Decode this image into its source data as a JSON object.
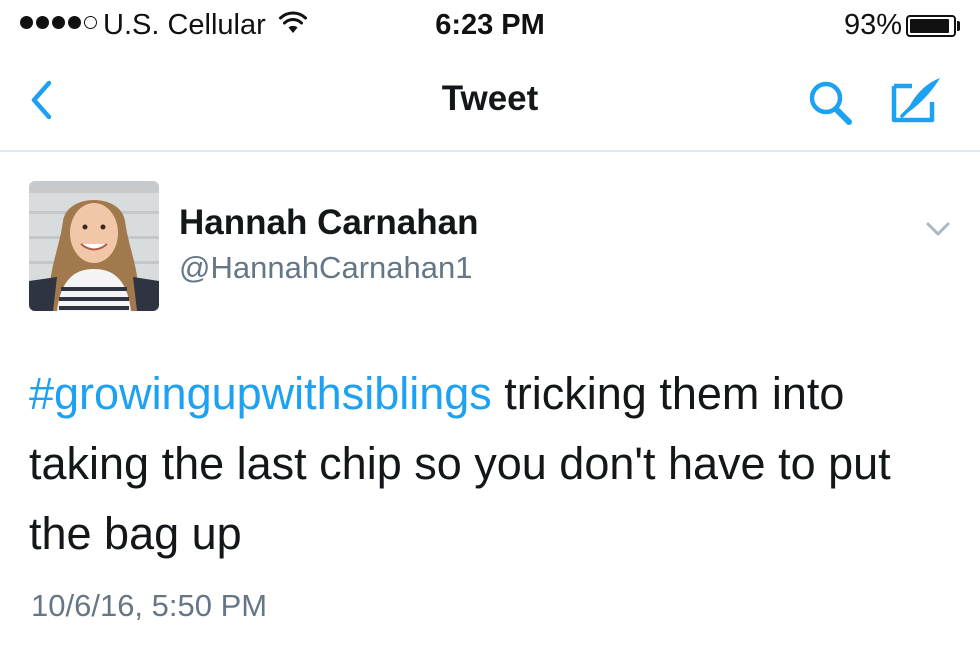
{
  "status_bar": {
    "carrier": "U.S. Cellular",
    "time": "6:23 PM",
    "battery_percent": "93%",
    "battery_level": 0.93,
    "signal_bars_filled": 4,
    "signal_bars_total": 5,
    "icons": [
      "signal-dots-icon",
      "wifi-icon",
      "battery-icon"
    ]
  },
  "nav": {
    "title": "Tweet",
    "back_icon": "chevron-left-icon",
    "search_icon": "search-icon",
    "compose_icon": "compose-icon"
  },
  "tweet": {
    "author": {
      "display_name": "Hannah Carnahan",
      "handle": "@HannahCarnahan1"
    },
    "hashtag": "#growingupwithsiblings",
    "text": "tricking them into taking the last chip so you don't have to put the bag up",
    "timestamp": "10/6/16, 5:50 PM",
    "menu_icon": "chevron-down-icon"
  },
  "colors": {
    "accent": "#1da1f2",
    "text": "#14171a",
    "muted": "#657786",
    "divider": "#e1e8ed"
  }
}
